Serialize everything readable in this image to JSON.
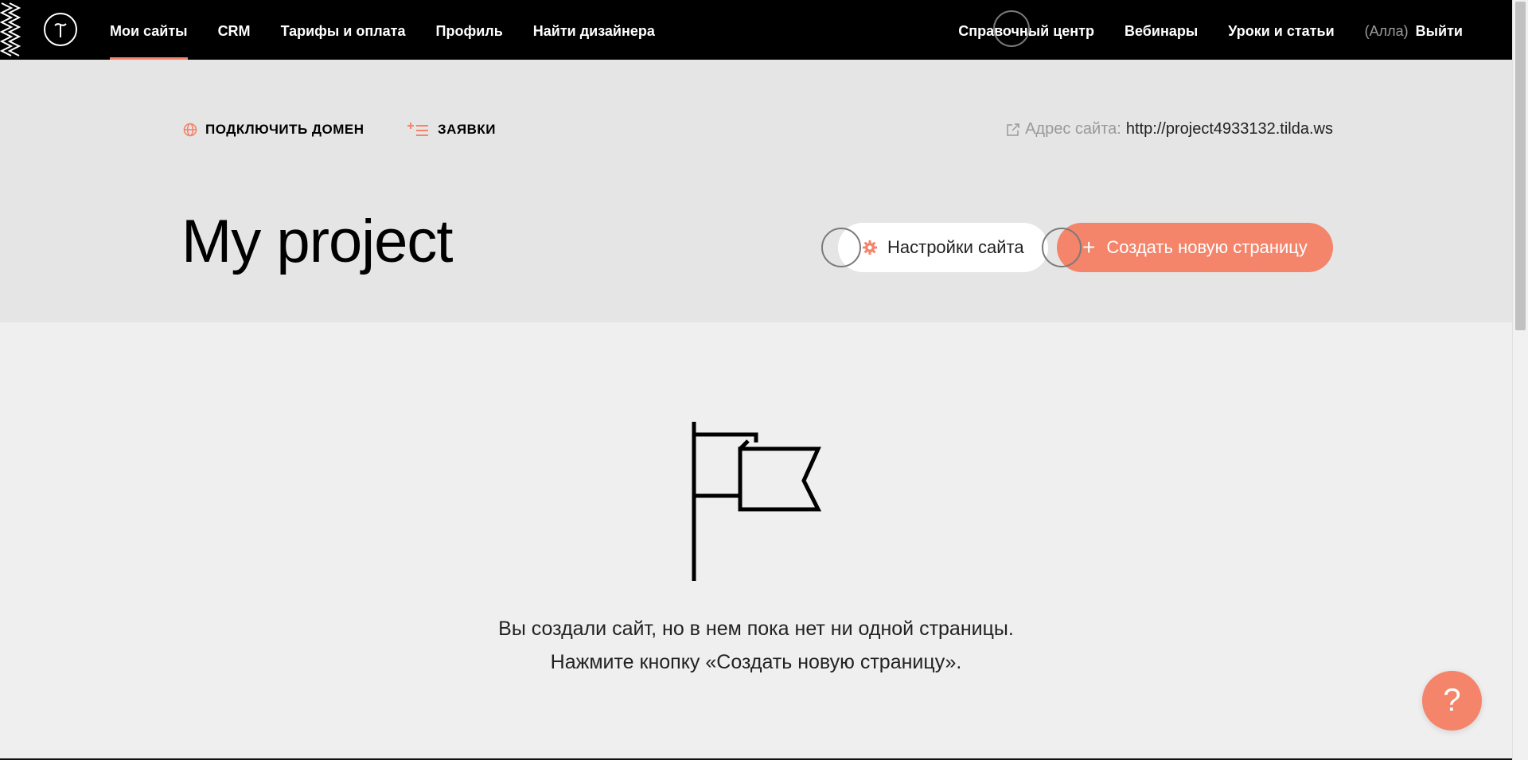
{
  "topbar": {
    "nav_left": [
      "Мои сайты",
      "CRM",
      "Тарифы и оплата",
      "Профиль",
      "Найти дизайнера"
    ],
    "nav_right": {
      "help_center": "Справочный центр",
      "webinars": "Вебинары",
      "lessons": "Уроки и статьи",
      "user": "(Алла)",
      "logout": "Выйти"
    },
    "active_item": "Мои сайты"
  },
  "header": {
    "connect_domain": "ПОДКЛЮЧИТЬ ДОМЕН",
    "requests": "ЗАЯВКИ",
    "address_label": "Адрес сайта:",
    "address_url": "http://project4933132.tilda.ws",
    "project_title": "My project",
    "settings_button": "Настройки сайта",
    "create_button": "Создать новую страницу",
    "create_plus": "+"
  },
  "empty_state": {
    "line1": "Вы создали сайт, но в нем пока нет ни одной страницы.",
    "line2": "Нажмите кнопку «Создать новую страницу».",
    "icon": "flag-icon"
  },
  "help": {
    "label": "?"
  },
  "colors": {
    "accent": "#f4846a",
    "topbar": "#000000",
    "header_bg": "#e5e5e5",
    "page_bg": "#efefef"
  }
}
